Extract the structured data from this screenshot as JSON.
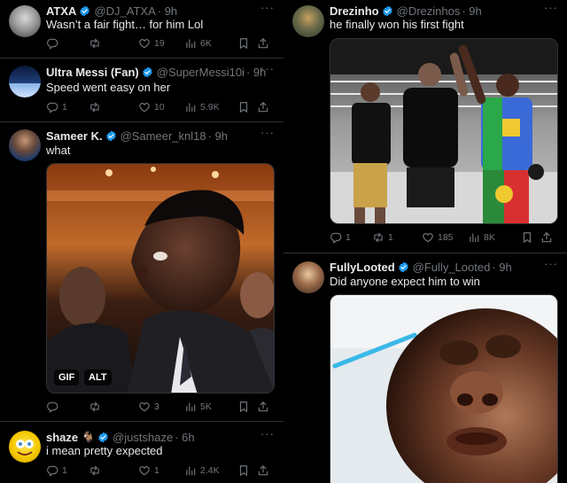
{
  "tweets_left": [
    {
      "name": "ATXA",
      "handle": "@DJ_ATXA",
      "time": "· 9h",
      "text": "Wasn’t a fair fight… for him Lol",
      "reply_count": "",
      "retweet_count": "",
      "like_count": "19",
      "view_count": "6K"
    },
    {
      "name": "Ultra Messi (Fan)",
      "handle": "@SuperMessi10i",
      "time": "· 9h",
      "text": "Speed went easy on her",
      "reply_count": "1",
      "retweet_count": "",
      "like_count": "10",
      "view_count": "5.9K"
    },
    {
      "name": "Sameer K.",
      "handle": "@Sameer_knl18",
      "time": "· 9h",
      "text": "what",
      "reply_count": "",
      "retweet_count": "",
      "like_count": "3",
      "view_count": "5K",
      "media_badges": [
        "GIF",
        "ALT"
      ]
    },
    {
      "name": "shaze",
      "emoji": "🐐",
      "handle": "@justshaze",
      "time": "· 6h",
      "text": "i mean pretty expected",
      "reply_count": "1",
      "retweet_count": "",
      "like_count": "1",
      "view_count": "2.4K"
    }
  ],
  "tweets_right": [
    {
      "name": "Drezinho",
      "handle": "@Drezinhos",
      "time": "· 9h",
      "text": "he finally won his first fight",
      "reply_count": "1",
      "retweet_count": "1",
      "like_count": "185",
      "view_count": "8K"
    },
    {
      "name": "FullyLooted",
      "handle": "@Fully_Looted",
      "time": "· 9h",
      "text": "Did anyone expect him to win",
      "reply_count": "",
      "retweet_count": "",
      "like_count": "",
      "view_count": ""
    }
  ],
  "more_glyph": "···",
  "colors": {
    "background": "#000000",
    "text_primary": "#e7e9ea",
    "text_secondary": "#71767b",
    "divider": "#2f3336",
    "verified_blue": "#1d9bf0"
  },
  "icons": [
    "reply-icon",
    "retweet-icon",
    "like-icon",
    "views-icon",
    "bookmark-icon",
    "share-icon",
    "verified-badge-icon",
    "more-icon"
  ]
}
